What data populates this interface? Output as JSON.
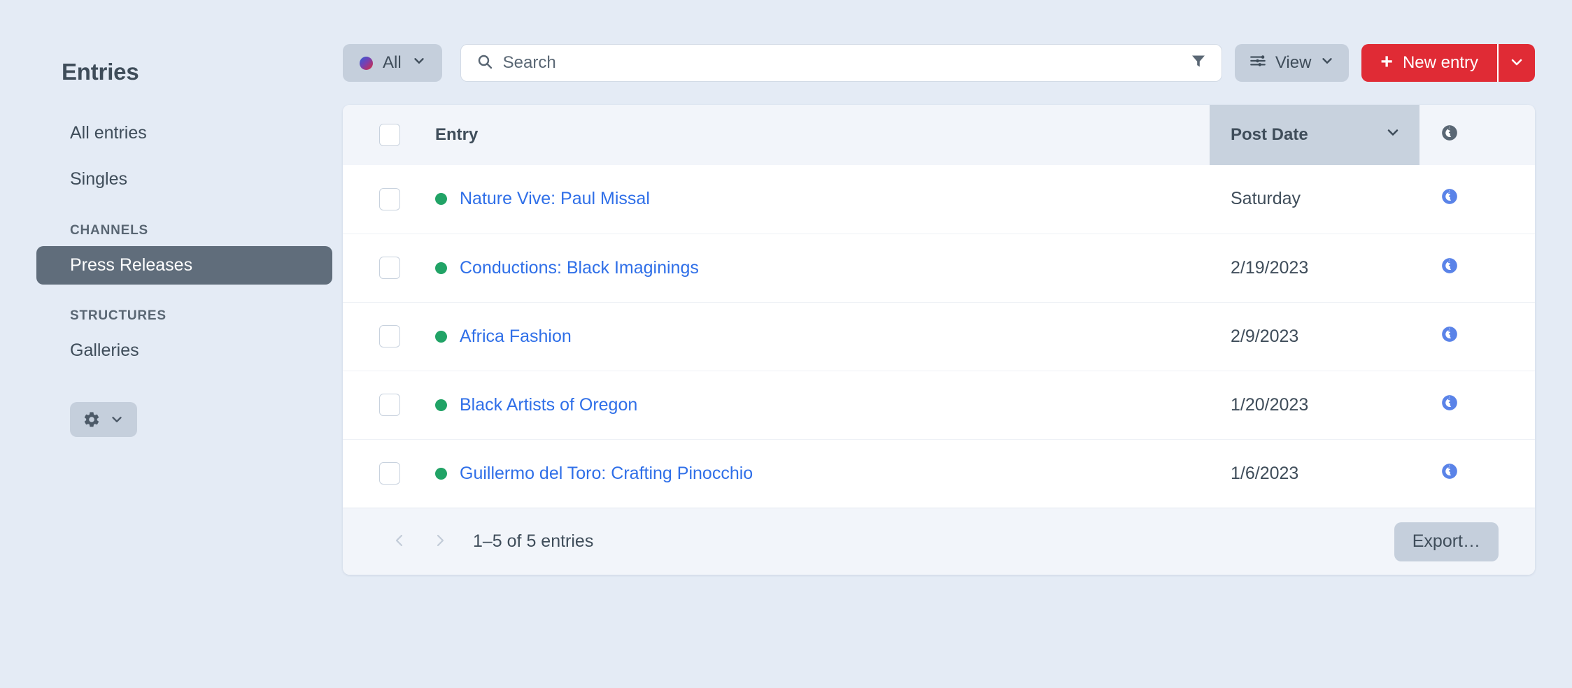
{
  "sidebar": {
    "title": "Entries",
    "items": [
      {
        "label": "All entries",
        "active": false
      },
      {
        "label": "Singles",
        "active": false
      }
    ],
    "groups": [
      {
        "heading": "CHANNELS",
        "items": [
          {
            "label": "Press Releases",
            "active": true
          }
        ]
      },
      {
        "heading": "STRUCTURES",
        "items": [
          {
            "label": "Galleries",
            "active": false
          }
        ]
      }
    ],
    "settings_button": {
      "icon": "gear-icon",
      "caret": "chevron-down-icon"
    }
  },
  "toolbar": {
    "status_filter": {
      "label": "All",
      "dot_gradient_from": "#2f5fd8",
      "dot_gradient_to": "#dd2a35",
      "caret": "chevron-down-icon"
    },
    "search": {
      "placeholder": "Search",
      "value": "",
      "icon": "search-icon",
      "filter_icon": "filter-icon"
    },
    "view_button": {
      "label": "View",
      "icon": "sliders-icon",
      "caret": "chevron-down-icon"
    },
    "new_entry_button": {
      "label": "New entry",
      "plus": "+",
      "caret": "chevron-down-icon",
      "color": "#e02b35"
    }
  },
  "table": {
    "columns": {
      "entry": "Entry",
      "post_date": "Post Date",
      "site": "globe-icon"
    },
    "sorted_column": "Post Date",
    "sort_caret": "chevron-down-icon",
    "rows": [
      {
        "title": "Nature Vive: Paul Missal",
        "status": "enabled",
        "status_color": "#21a366",
        "post_date": "Saturday",
        "site_icon": "globe-icon"
      },
      {
        "title": "Conductions: Black Imaginings",
        "status": "enabled",
        "status_color": "#21a366",
        "post_date": "2/19/2023",
        "site_icon": "globe-icon"
      },
      {
        "title": "Africa Fashion",
        "status": "enabled",
        "status_color": "#21a366",
        "post_date": "2/9/2023",
        "site_icon": "globe-icon"
      },
      {
        "title": "Black Artists of Oregon",
        "status": "enabled",
        "status_color": "#21a366",
        "post_date": "1/20/2023",
        "site_icon": "globe-icon"
      },
      {
        "title": "Guillermo del Toro: Crafting Pinocchio",
        "status": "enabled",
        "status_color": "#21a366",
        "post_date": "1/6/2023",
        "site_icon": "globe-icon"
      }
    ]
  },
  "footer": {
    "prev_icon": "chevron-left-icon",
    "next_icon": "chevron-right-icon",
    "count_label": "1–5 of 5 entries",
    "export_label": "Export…"
  },
  "colors": {
    "page_background": "#e4ebf5",
    "sidebar_active": "#606d7b",
    "link": "#2f6fe8",
    "accent_red": "#e02b35",
    "status_green": "#21a366",
    "button_grey": "#c5cfdc",
    "header_grey": "#f2f5fa",
    "sorted_header_grey": "#c8d2de"
  }
}
